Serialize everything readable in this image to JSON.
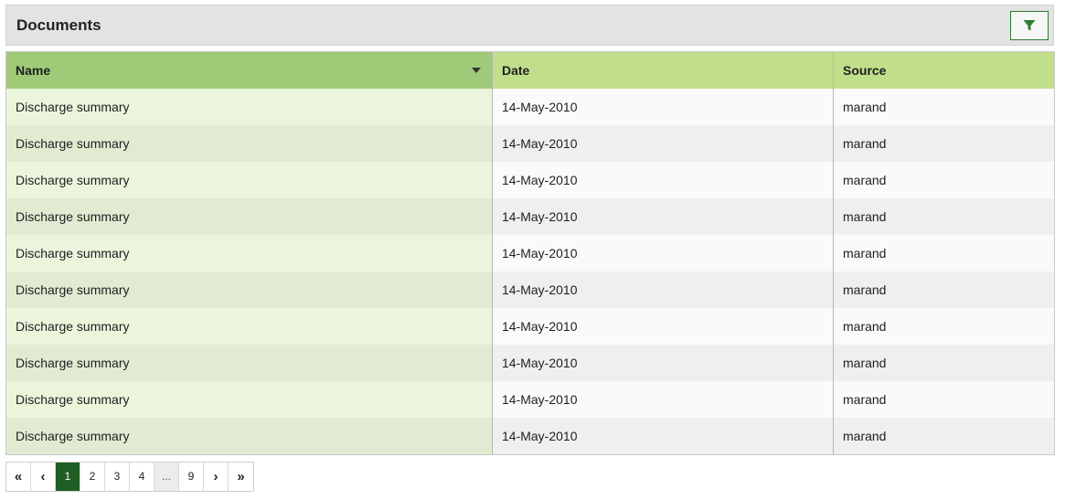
{
  "panel": {
    "title": "Documents",
    "filter_icon": "filter-icon"
  },
  "table": {
    "columns": [
      "Name",
      "Date",
      "Source"
    ],
    "sorted_column": "Name",
    "rows": [
      {
        "name": "Discharge summary",
        "date": "14-May-2010",
        "source": "marand"
      },
      {
        "name": "Discharge summary",
        "date": "14-May-2010",
        "source": "marand"
      },
      {
        "name": "Discharge summary",
        "date": "14-May-2010",
        "source": "marand"
      },
      {
        "name": "Discharge summary",
        "date": "14-May-2010",
        "source": "marand"
      },
      {
        "name": "Discharge summary",
        "date": "14-May-2010",
        "source": "marand"
      },
      {
        "name": "Discharge summary",
        "date": "14-May-2010",
        "source": "marand"
      },
      {
        "name": "Discharge summary",
        "date": "14-May-2010",
        "source": "marand"
      },
      {
        "name": "Discharge summary",
        "date": "14-May-2010",
        "source": "marand"
      },
      {
        "name": "Discharge summary",
        "date": "14-May-2010",
        "source": "marand"
      },
      {
        "name": "Discharge summary",
        "date": "14-May-2010",
        "source": "marand"
      }
    ]
  },
  "pagination": {
    "first": "«",
    "prev": "‹",
    "pages": [
      "1",
      "2",
      "3",
      "4",
      "...",
      "9"
    ],
    "current": "1",
    "next": "›",
    "last": "»"
  },
  "colors": {
    "accent": "#1f5d24",
    "header_primary": "#9fcb79",
    "header_secondary": "#c1df8b"
  }
}
